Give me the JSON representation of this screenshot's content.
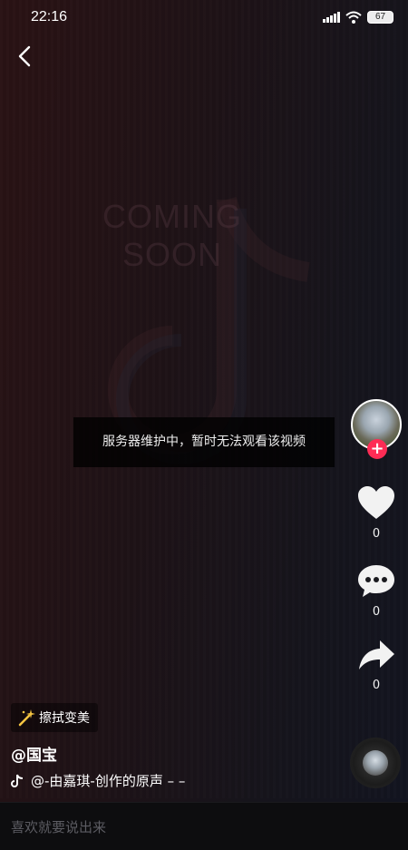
{
  "status_bar": {
    "time": "22:16",
    "battery": "67"
  },
  "video": {
    "background_text_line1": "COMING",
    "background_text_line2": "SOON",
    "toast": "服务器维护中，暂时无法观看该视频"
  },
  "actions": {
    "like_count": "0",
    "comment_count": "0",
    "share_count": "0"
  },
  "effect_tag": {
    "label": "擦拭变美"
  },
  "author": {
    "name": "@国宝"
  },
  "music": {
    "title": "@-由嘉琪-创作的原声 – –"
  },
  "comment": {
    "placeholder": "喜欢就要说出来"
  },
  "colors": {
    "accent": "#fe2c55"
  },
  "icons": [
    "back-icon",
    "heart-icon",
    "comment-icon",
    "share-icon",
    "music-note-icon",
    "magic-wand-icon",
    "follow-plus-icon"
  ]
}
